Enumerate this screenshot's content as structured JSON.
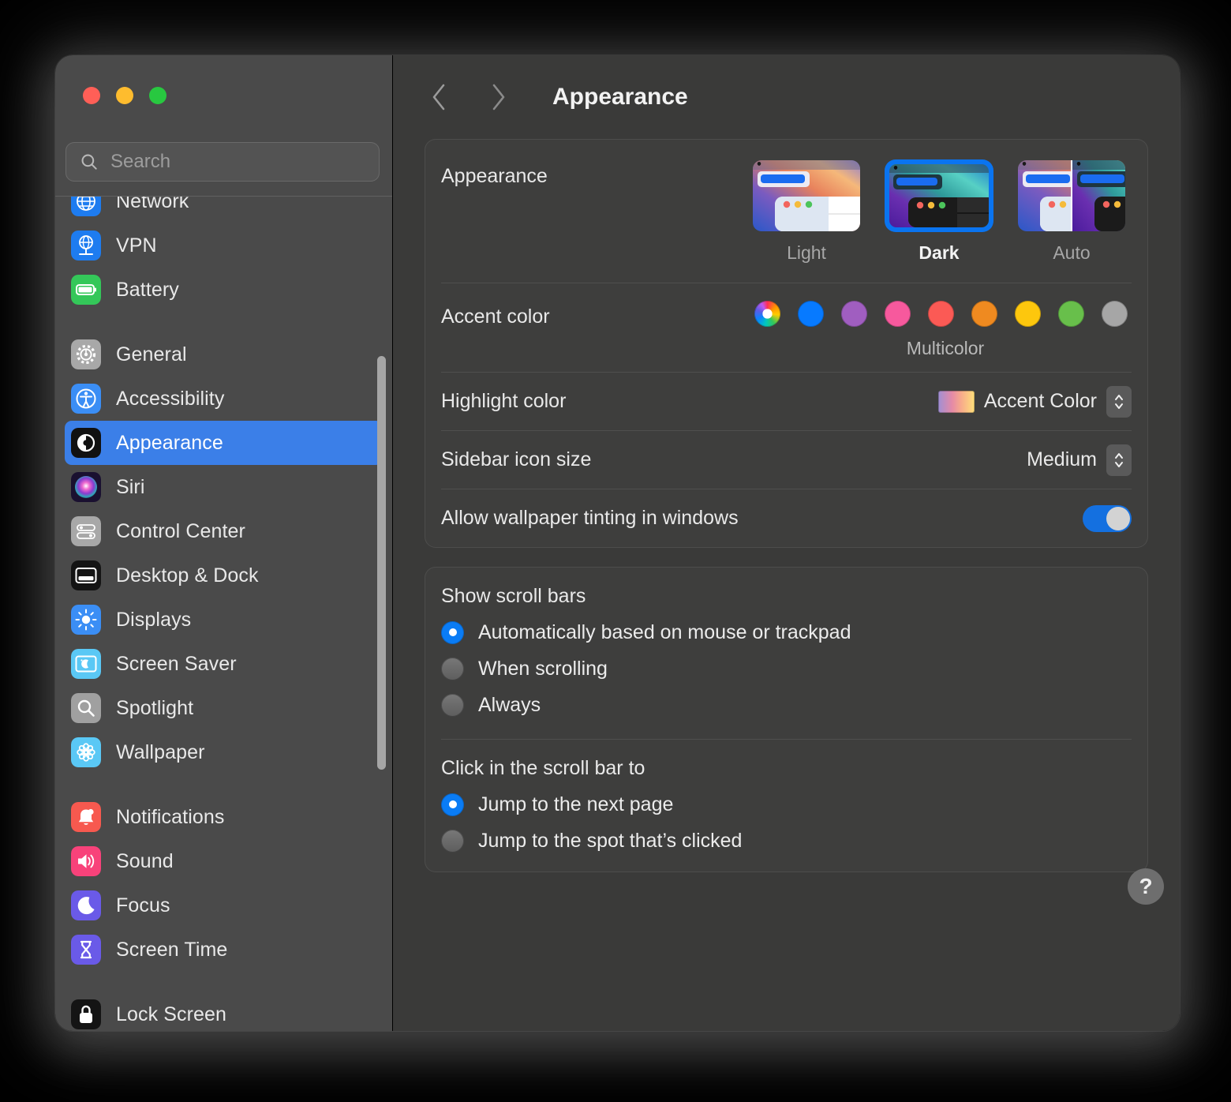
{
  "window": {
    "traffic_lights": [
      "close",
      "minimize",
      "zoom"
    ],
    "colors": {
      "close": "#ff5f57",
      "minimize": "#febc2e",
      "zoom": "#28c840"
    }
  },
  "sidebar": {
    "search": {
      "placeholder": "Search",
      "value": "",
      "icon": "search-icon"
    },
    "items": [
      {
        "label": "Network",
        "icon": "network-globe-icon",
        "selected": false,
        "clipped": true
      },
      {
        "label": "VPN",
        "icon": "vpn-globe-icon",
        "selected": false
      },
      {
        "label": "Battery",
        "icon": "battery-icon",
        "selected": false
      },
      {
        "gap": true
      },
      {
        "label": "General",
        "icon": "gear-icon",
        "selected": false
      },
      {
        "label": "Accessibility",
        "icon": "accessibility-icon",
        "selected": false
      },
      {
        "label": "Appearance",
        "icon": "appearance-icon",
        "selected": true
      },
      {
        "label": "Siri",
        "icon": "siri-icon",
        "selected": false
      },
      {
        "label": "Control Center",
        "icon": "control-center-icon",
        "selected": false
      },
      {
        "label": "Desktop & Dock",
        "icon": "desktop-dock-icon",
        "selected": false
      },
      {
        "label": "Displays",
        "icon": "displays-icon",
        "selected": false
      },
      {
        "label": "Screen Saver",
        "icon": "screen-saver-icon",
        "selected": false
      },
      {
        "label": "Spotlight",
        "icon": "spotlight-icon",
        "selected": false
      },
      {
        "label": "Wallpaper",
        "icon": "wallpaper-icon",
        "selected": false
      },
      {
        "gap": true
      },
      {
        "label": "Notifications",
        "icon": "notifications-icon",
        "selected": false
      },
      {
        "label": "Sound",
        "icon": "sound-icon",
        "selected": false
      },
      {
        "label": "Focus",
        "icon": "focus-moon-icon",
        "selected": false
      },
      {
        "label": "Screen Time",
        "icon": "screen-time-icon",
        "selected": false
      },
      {
        "gap": true
      },
      {
        "label": "Lock Screen",
        "icon": "lock-screen-icon",
        "selected": false
      }
    ]
  },
  "toolbar": {
    "back_icon": "chevron-left-icon",
    "forward_icon": "chevron-right-icon",
    "title": "Appearance"
  },
  "main": {
    "appearance": {
      "label": "Appearance",
      "modes": [
        {
          "label": "Light",
          "selected": false
        },
        {
          "label": "Dark",
          "selected": true
        },
        {
          "label": "Auto",
          "selected": false
        }
      ]
    },
    "accent_color": {
      "label": "Accent color",
      "selected_name": "Multicolor",
      "swatches": [
        {
          "name": "Multicolor",
          "color": "multicolor",
          "selected": true
        },
        {
          "name": "Blue",
          "color": "#077aff"
        },
        {
          "name": "Purple",
          "color": "#a05ec0"
        },
        {
          "name": "Pink",
          "color": "#f7599d"
        },
        {
          "name": "Red",
          "color": "#fb5a55"
        },
        {
          "name": "Orange",
          "color": "#ef8a20"
        },
        {
          "name": "Yellow",
          "color": "#fdc70d"
        },
        {
          "name": "Green",
          "color": "#68bf4b"
        },
        {
          "name": "Graphite",
          "color": "#a6a6a6"
        }
      ]
    },
    "highlight_color": {
      "label": "Highlight color",
      "value": "Accent Color",
      "chip": "accent-gradient-chip",
      "stepper_icon": "chevron-up-down-icon"
    },
    "sidebar_icon_size": {
      "label": "Sidebar icon size",
      "value": "Medium",
      "stepper_icon": "chevron-up-down-icon"
    },
    "wallpaper_tinting": {
      "label": "Allow wallpaper tinting in windows",
      "enabled": true
    },
    "show_scroll_bars": {
      "title": "Show scroll bars",
      "options": [
        {
          "label": "Automatically based on mouse or trackpad",
          "selected": true
        },
        {
          "label": "When scrolling",
          "selected": false
        },
        {
          "label": "Always",
          "selected": false
        }
      ]
    },
    "click_scroll_bar": {
      "title": "Click in the scroll bar to",
      "options": [
        {
          "label": "Jump to the next page",
          "selected": true
        },
        {
          "label": "Jump to the spot that’s clicked",
          "selected": false
        }
      ]
    },
    "help": {
      "label": "?",
      "icon": "help-question-icon"
    }
  }
}
